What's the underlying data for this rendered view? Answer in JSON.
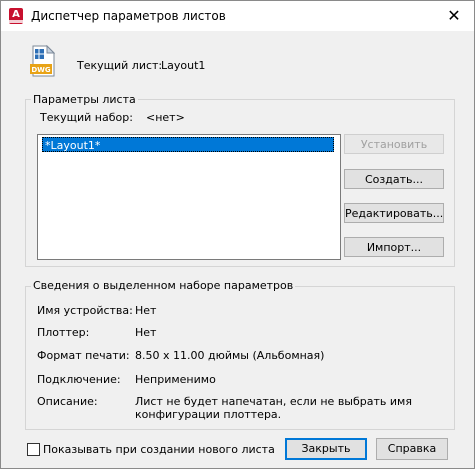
{
  "window": {
    "title": "Диспетчер параметров листов",
    "close_glyph": "✕"
  },
  "current_sheet": {
    "label": "Текущий лист:",
    "value": "Layout1"
  },
  "sheet_params": {
    "group_title": "Параметры листа",
    "current_set_label": "Текущий набор:",
    "current_set_value": "<нет>",
    "list_items": [
      "*Layout1*"
    ],
    "buttons": {
      "set": "Установить",
      "create": "Создать...",
      "edit": "Редактировать...",
      "import": "Импорт..."
    }
  },
  "details": {
    "group_title": "Сведения о выделенном наборе параметров",
    "rows": [
      {
        "label": "Имя устройства:",
        "value": "Нет"
      },
      {
        "label": "Плоттер:",
        "value": "Нет"
      },
      {
        "label": "Формат печати:",
        "value": "8.50 x 11.00 дюймы (Альбомная)"
      },
      {
        "label": "Подключение:",
        "value": "Неприменимо"
      },
      {
        "label": "Описание:",
        "value": "Лист не будет напечатан, если не выбрать имя",
        "value2": "конфигурации плоттера."
      }
    ]
  },
  "footer": {
    "checkbox_label": "Показывать при создании нового листа",
    "checkbox_checked": false,
    "close_button": "Закрыть",
    "help_button": "Справка"
  },
  "icons": {
    "app": "autocad-app-icon",
    "dwg_text": "DWG"
  },
  "colors": {
    "selection": "#0078d7",
    "app_icon": "#c8102e"
  }
}
